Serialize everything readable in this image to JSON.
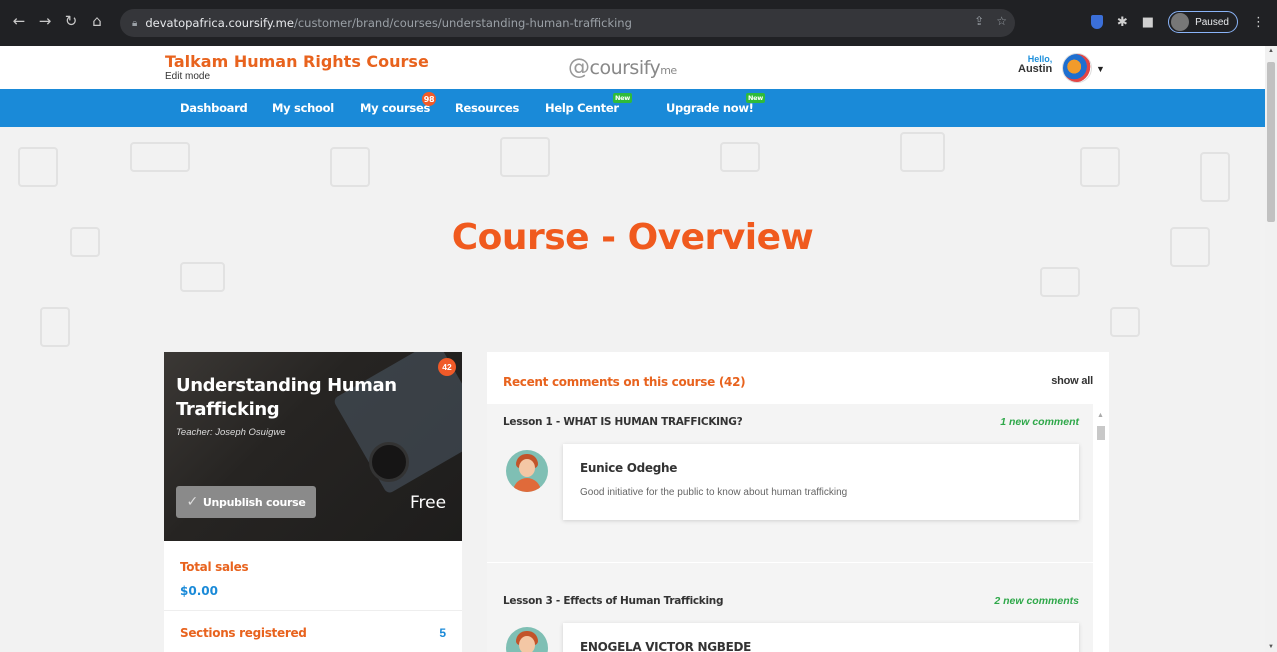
{
  "browser": {
    "url_host": "devatopafrica.coursify.me",
    "url_path": "/customer/brand/courses/understanding-human-trafficking",
    "profile_status": "Paused"
  },
  "header": {
    "brand_title": "Talkam Human Rights Course",
    "mode": "Edit mode",
    "logo_text": "coursify",
    "logo_suffix": "me",
    "greeting": "Hello,",
    "user_name": "Austin"
  },
  "nav": {
    "items": [
      {
        "label": "Dashboard"
      },
      {
        "label": "My school"
      },
      {
        "label": "My courses",
        "badge": "98"
      },
      {
        "label": "Resources"
      },
      {
        "label": "Help Center",
        "badge": "New"
      },
      {
        "label": "Upgrade now!",
        "badge": "New"
      }
    ]
  },
  "page": {
    "title": "Course - Overview"
  },
  "course": {
    "name": "Understanding Human Trafficking",
    "teacher": "Teacher: Joseph Osuigwe",
    "comment_count": "42",
    "unpublish_label": "Unpublish course",
    "price": "Free",
    "stats": [
      {
        "label": "Total sales",
        "value": "$0.00"
      },
      {
        "label": "Sections registered",
        "value": "5"
      }
    ]
  },
  "comments": {
    "title": "Recent comments on this course (42)",
    "show_all": "show all",
    "lessons": [
      {
        "name": "Lesson 1 - WHAT IS HUMAN TRAFFICKING?",
        "new_label": "1 new comment",
        "author": "Eunice Odeghe",
        "text": "Good initiative for the public to know about human trafficking"
      },
      {
        "name": "Lesson 3 - Effects of Human Trafficking",
        "new_label": "2 new comments",
        "author": "ENOGELA VICTOR NGBEDE",
        "text": ""
      }
    ]
  },
  "colors": {
    "accent_orange": "#e8631e",
    "nav_blue": "#1a8ad8",
    "new_green": "#2fa84a"
  }
}
